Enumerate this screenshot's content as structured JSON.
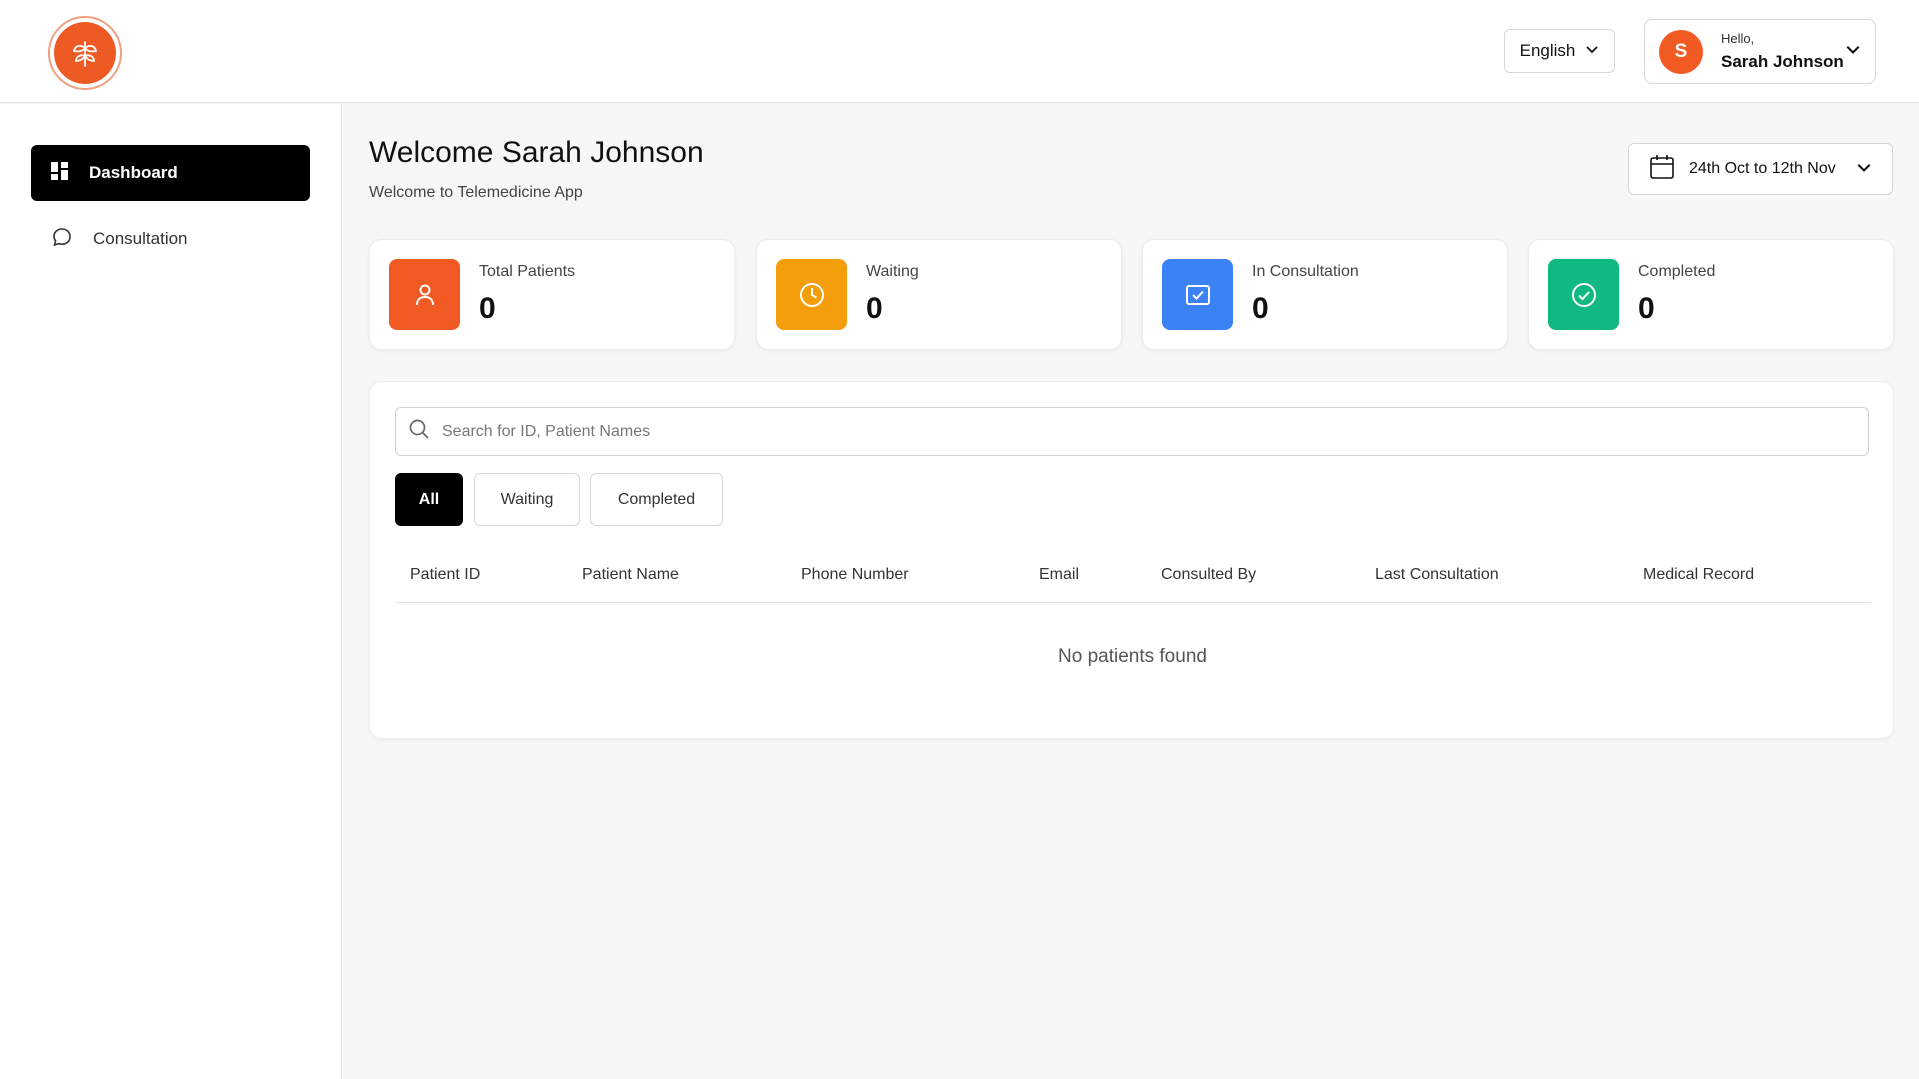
{
  "header": {
    "logo_alt": "Organization logo",
    "language": "English",
    "user": {
      "initial": "S",
      "greeting": "Hello,",
      "name": "Sarah Johnson"
    }
  },
  "sidebar": {
    "items": [
      {
        "label": "Dashboard",
        "icon": "grid-icon",
        "active": true
      },
      {
        "label": "Consultation",
        "icon": "chat-bubble-icon",
        "active": false
      }
    ]
  },
  "main": {
    "title": "Welcome Sarah Johnson",
    "subtitle": "Welcome to Telemedicine App",
    "date_range": "24th Oct to 12th Nov",
    "stats": [
      {
        "label": "Total Patients",
        "value": "0",
        "color": "#f15a22",
        "icon": "user-icon"
      },
      {
        "label": "Waiting",
        "value": "0",
        "color": "#f59e0b",
        "icon": "clock-icon"
      },
      {
        "label": "In Consultation",
        "value": "0",
        "color": "#3b82f6",
        "icon": "calendar-check-icon"
      },
      {
        "label": "Completed",
        "value": "0",
        "color": "#10b981",
        "icon": "check-circle-icon"
      }
    ],
    "search": {
      "placeholder": "Search for ID, Patient Names",
      "value": ""
    },
    "filters": [
      "All",
      "Waiting",
      "Completed"
    ],
    "table": {
      "columns": [
        "Patient ID",
        "Patient Name",
        "Phone Number",
        "Email",
        "Consulted By",
        "Last Consultation",
        "Medical Record"
      ],
      "rows": [],
      "empty_message": "No patients found"
    }
  }
}
